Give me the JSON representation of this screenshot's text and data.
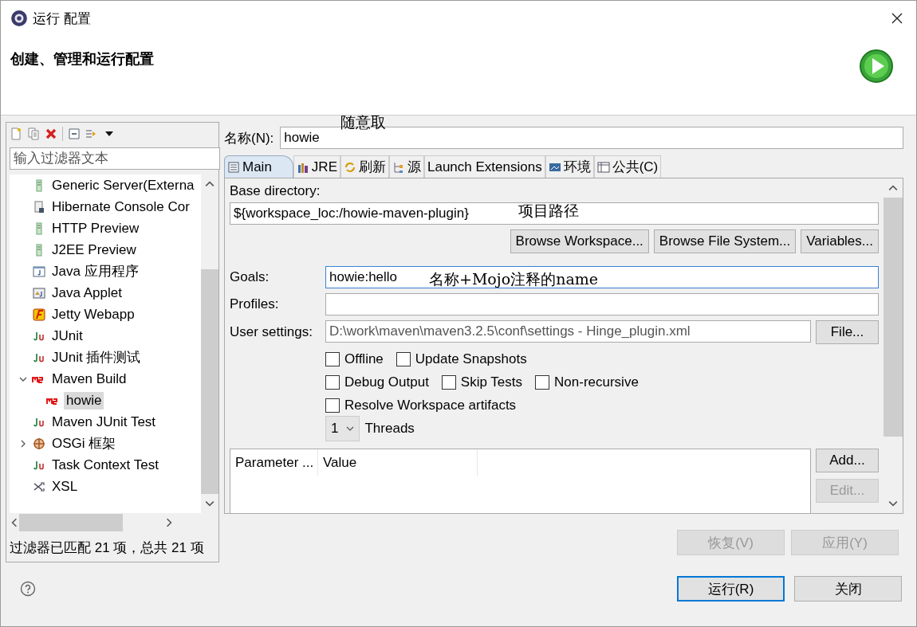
{
  "window": {
    "title": "运行 配置"
  },
  "header": {
    "title": "创建、管理和运行配置"
  },
  "sidebar": {
    "toolbar": [
      {
        "kind": "new"
      },
      {
        "kind": "copy"
      },
      {
        "kind": "delete"
      },
      {
        "kind": "collapse"
      },
      {
        "kind": "filter"
      },
      {
        "kind": "menu"
      }
    ],
    "filter": {
      "placeholder": "输入过滤器文本"
    },
    "tree": [
      {
        "label": "Generic Server(Externa",
        "kind": "server",
        "selected": false
      },
      {
        "label": "Hibernate Console Cor",
        "kind": "hibernate",
        "selected": false
      },
      {
        "label": "HTTP Preview",
        "kind": "server",
        "selected": false
      },
      {
        "label": "J2EE Preview",
        "kind": "server",
        "selected": false
      },
      {
        "label": "Java 应用程序",
        "kind": "java",
        "selected": false
      },
      {
        "label": "Java Applet",
        "kind": "applet",
        "selected": false
      },
      {
        "label": "Jetty Webapp",
        "kind": "jetty",
        "selected": false
      },
      {
        "label": "JUnit",
        "kind": "junit",
        "selected": false
      },
      {
        "label": "JUnit 插件测试",
        "kind": "junit",
        "selected": false
      },
      {
        "label": "Maven Build",
        "kind": "m2",
        "selected": false,
        "expanded": true,
        "children": [
          {
            "label": "howie",
            "kind": "m2",
            "selected": true
          }
        ]
      },
      {
        "label": "Maven JUnit Test",
        "kind": "junit",
        "selected": false
      },
      {
        "label": "OSGi 框架",
        "kind": "osgi",
        "selected": false,
        "expanded": false
      },
      {
        "label": "Task Context Test",
        "kind": "junit",
        "selected": false
      },
      {
        "label": "XSL",
        "kind": "xsl",
        "selected": false
      }
    ],
    "status": "过滤器已匹配 21 项，总共 21 项"
  },
  "name_field": {
    "label": "名称(N):",
    "value": "howie"
  },
  "tabs": [
    {
      "label": "Main",
      "kind": "doc",
      "selected": true
    },
    {
      "label": "JRE",
      "kind": "books",
      "selected": false
    },
    {
      "label": "刷新",
      "kind": "refresh",
      "selected": false
    },
    {
      "label": "源",
      "kind": "source",
      "selected": false
    },
    {
      "label": "Launch Extensions",
      "kind": "none",
      "selected": false
    },
    {
      "label": "环境",
      "kind": "env",
      "selected": false
    },
    {
      "label": "公共(C)",
      "kind": "table",
      "selected": false
    }
  ],
  "main": {
    "base_directory": {
      "label": "Base directory:",
      "value": "${workspace_loc:/howie-maven-plugin}"
    },
    "browse_buttons": [
      "Browse Workspace...",
      "Browse File System...",
      "Variables..."
    ],
    "goals": {
      "label": "Goals:",
      "value": "howie:hello",
      "focused": true
    },
    "profiles": {
      "label": "Profiles:"
    },
    "user_settings": {
      "label": "User settings:",
      "value": "D:\\work\\maven\\maven3.2.5\\conf\\settings - Hinge_plugin.xml",
      "button": "File..."
    },
    "checkbox_rows": [
      [
        {
          "label": "Offline",
          "checked": false
        },
        {
          "label": "Update Snapshots",
          "checked": false
        }
      ],
      [
        {
          "label": "Debug Output",
          "checked": false
        },
        {
          "label": "Skip Tests",
          "checked": false
        },
        {
          "label": "Non-recursive",
          "checked": false
        }
      ],
      [
        {
          "label": "Resolve Workspace artifacts",
          "checked": false
        }
      ]
    ],
    "threads": {
      "value": "1",
      "label": "Threads"
    },
    "table": {
      "columns": [
        "Parameter ...",
        "Value"
      ]
    },
    "table_buttons": [
      {
        "label": "Add...",
        "disabled": false
      },
      {
        "label": "Edit...",
        "disabled": true
      }
    ]
  },
  "actions": [
    {
      "label": "恢复(V)",
      "disabled": true
    },
    {
      "label": "应用(Y)",
      "disabled": true
    }
  ],
  "footer": [
    {
      "label": "运行(R)",
      "default": true
    },
    {
      "label": "关闭",
      "default": false
    }
  ],
  "annotations": {
    "name": "随意取",
    "base_directory": "项目路径",
    "goals": "名称+Mojo注释的name"
  }
}
